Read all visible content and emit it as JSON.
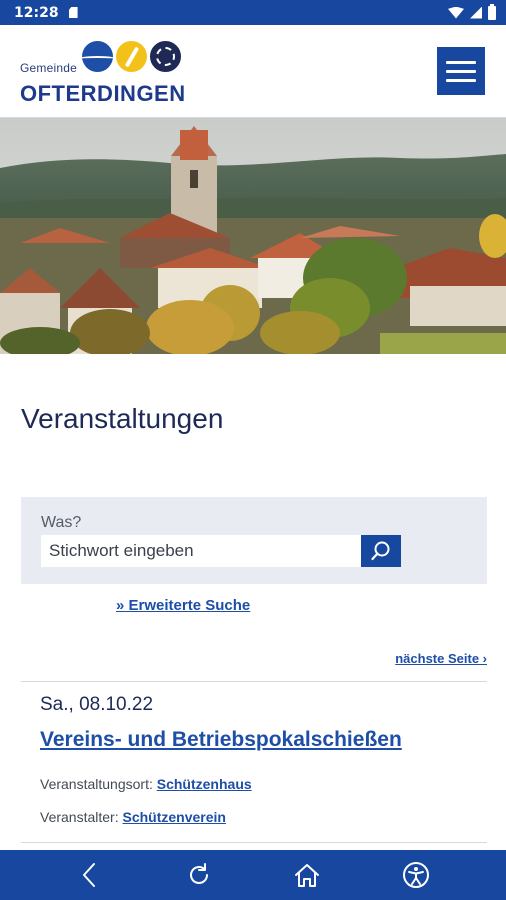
{
  "status_bar": {
    "time": "12:28",
    "icons": [
      "sdcard-icon",
      "wifi-icon",
      "signal-icon",
      "battery-icon"
    ]
  },
  "header": {
    "logo_prefix": "Gemeinde",
    "logo_name": "OFTERDINGEN",
    "menu_icon": "hamburger-menu-icon"
  },
  "hero": {
    "icon": "village-photo"
  },
  "page": {
    "title": "Veranstaltungen"
  },
  "search": {
    "label": "Was?",
    "placeholder": "Stichwort eingeben",
    "value": "",
    "button_icon": "search-icon"
  },
  "links": {
    "advanced_search": "» Erweiterte Suche",
    "next_page": "nächste Seite ›"
  },
  "events": [
    {
      "date": "Sa., 08.10.22",
      "title": "Vereins- und Betriebspokalschießen",
      "location_label": "Veranstaltungsort:",
      "location": "Schützenhaus",
      "organizer_label": "Veranstalter:",
      "organizer": "Schützenverein"
    }
  ],
  "bottom_nav": {
    "icons": [
      "back-icon",
      "reload-icon",
      "home-icon",
      "accessibility-icon"
    ]
  },
  "colors": {
    "primary": "#17479e",
    "link": "#1d4ea8",
    "text": "#1e2a55",
    "search_bg": "#e8ecf2",
    "logo_yellow": "#f2c21a"
  }
}
